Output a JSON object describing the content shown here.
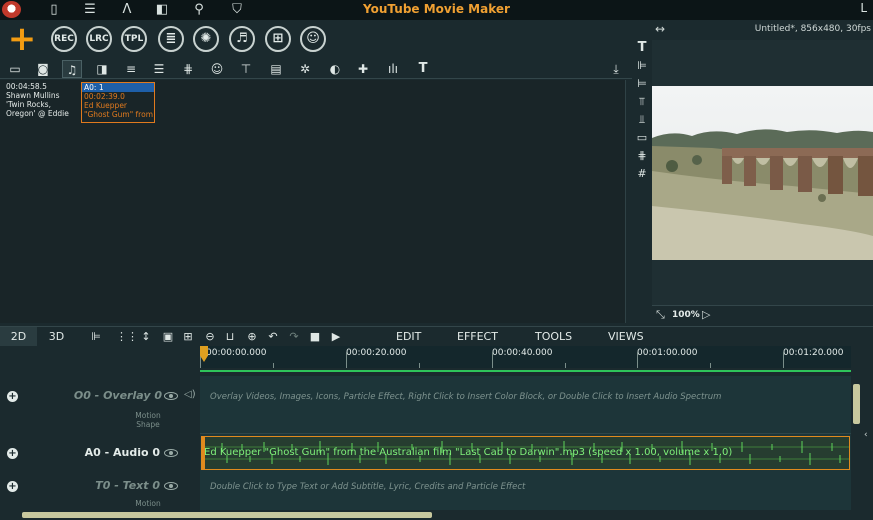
{
  "app": {
    "title": "YouTube Movie Maker"
  },
  "titlebar_icons": [
    "phone-icon",
    "list-icon",
    "text-style-icon",
    "columns-icon",
    "search-icon",
    "shirt-icon"
  ],
  "big_toolbar": {
    "add_label": "+",
    "buttons": [
      {
        "name": "rec-button",
        "label": "REC"
      },
      {
        "name": "lrc-button",
        "label": "LRC"
      },
      {
        "name": "tpl-button",
        "label": "TPL"
      },
      {
        "name": "list-button",
        "label": "≣"
      },
      {
        "name": "settings-button",
        "label": "✺"
      },
      {
        "name": "music-button",
        "label": "♬"
      },
      {
        "name": "subtitle-button",
        "label": "⊞"
      },
      {
        "name": "account-button",
        "label": "☺"
      }
    ]
  },
  "media": {
    "item1": {
      "lines": [
        "00:04:58.5",
        "Shawn Mullins",
        "'Twin Rocks,",
        "Oregon' @ Eddie"
      ]
    },
    "item2": {
      "lines": [
        "A0: 1",
        "00:02:39.0",
        "Ed Kuepper",
        "\"Ghost Gum\" from"
      ]
    }
  },
  "preview": {
    "info": "Untitled*, 856x480, 30fps",
    "zoom": "100%"
  },
  "timeline": {
    "tab_2d": "2D",
    "tab_3d": "3D",
    "menus": [
      "EDIT",
      "EFFECT",
      "TOOLS",
      "VIEWS"
    ],
    "ruler_labels": [
      "00:00:00.000",
      "00:00:20.000",
      "00:00:40.000",
      "00:01:00.000",
      "00:01:20.000"
    ],
    "tracks": {
      "overlay": {
        "name": "O0 - Overlay 0",
        "sub1": "Motion",
        "sub2": "Shape",
        "hint": "Overlay Videos, Images, Icons, Particle Effect, Right Click to Insert Color Block, or Double Click to Insert Audio Spectrum"
      },
      "audio": {
        "name": "A0 - Audio 0",
        "clip": "Ed Kuepper \"Ghost Gum\" from the Australian film \"Last Cab to Darwin\".mp3  (speed x 1.00, volume x 1.0)"
      },
      "text": {
        "name": "T0 - Text 0",
        "sub1": "Motion",
        "hint": "Double Click to Type Text or Add Subtitle, Lyric, Credits and Particle Effect"
      }
    }
  },
  "colors": {
    "accent": "#f0a032",
    "audio_wave": "#7ff07a",
    "clip_border": "#e08a1e"
  }
}
